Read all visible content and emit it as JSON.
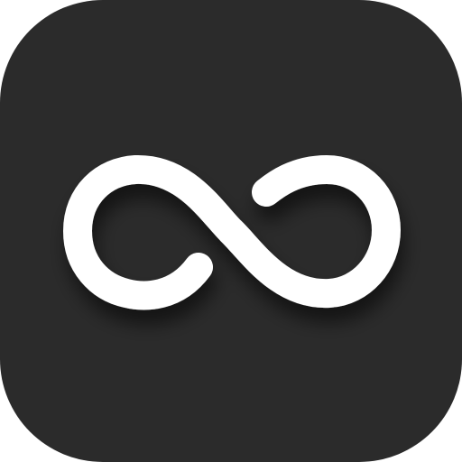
{
  "app_icon": {
    "icon": "infinity-icon",
    "colors": {
      "background": "#2b2b2b",
      "glyph": "#ffffff",
      "shadow": "#000000"
    }
  }
}
